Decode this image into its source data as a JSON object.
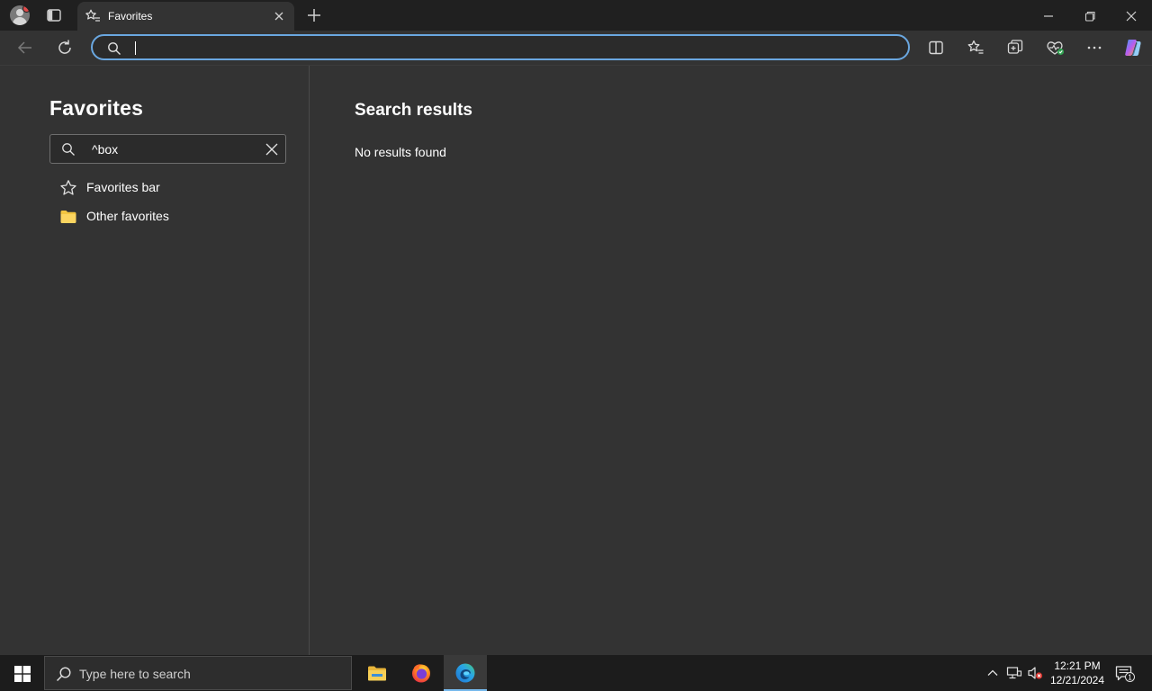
{
  "browser": {
    "tab": {
      "title": "Favorites",
      "icon": "star-list-icon"
    },
    "address_bar": {
      "value": "",
      "placeholder": ""
    },
    "toolbar_icons": [
      "back-icon",
      "refresh-icon",
      "split-screen-icon",
      "favorites-icon",
      "collections-icon",
      "browser-essentials-icon",
      "more-icon",
      "copilot-icon"
    ],
    "window_controls": [
      "minimize-icon",
      "restore-icon",
      "close-icon"
    ]
  },
  "sidebar": {
    "title": "Favorites",
    "search": {
      "value": "^box",
      "placeholder": ""
    },
    "items": [
      {
        "label": "Favorites bar",
        "icon": "star-icon"
      },
      {
        "label": "Other favorites",
        "icon": "folder-icon",
        "icon_color": "#f2c541"
      }
    ]
  },
  "main": {
    "heading": "Search results",
    "empty_message": "No results found"
  },
  "taskbar": {
    "search_placeholder": "Type here to search",
    "apps": [
      {
        "name": "File Explorer",
        "icon": "file-explorer-icon"
      },
      {
        "name": "Firefox",
        "icon": "firefox-icon"
      },
      {
        "name": "Microsoft Edge",
        "icon": "edge-icon",
        "active": true
      }
    ],
    "clock": {
      "time": "12:21 PM",
      "date": "12/21/2024"
    },
    "notification_count": "1"
  },
  "colors": {
    "accent": "#6aa7e0",
    "background": "#333333",
    "tabstrip": "#202020",
    "taskbar": "#1c1c1c"
  }
}
